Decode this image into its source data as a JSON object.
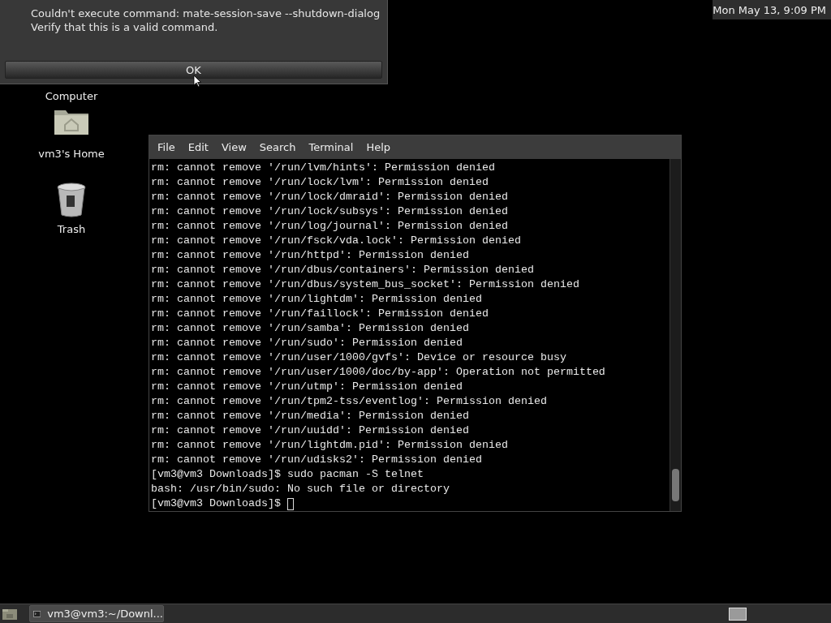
{
  "dialog": {
    "message": [
      "Couldn't execute command: mate-session-save --shutdown-dialog",
      "Verify that this is a valid command."
    ],
    "button": "OK"
  },
  "top_panel": {
    "clock": "Mon May 13,  9:09 PM"
  },
  "desktop_icons": [
    {
      "kind": "computer",
      "label": "Computer"
    },
    {
      "kind": "home",
      "label": "vm3's Home"
    },
    {
      "kind": "trash",
      "label": "Trash"
    }
  ],
  "terminal": {
    "menu": [
      "File",
      "Edit",
      "View",
      "Search",
      "Terminal",
      "Help"
    ],
    "lines": [
      "rm: cannot remove '/run/lvm/hints': Permission denied",
      "rm: cannot remove '/run/lock/lvm': Permission denied",
      "rm: cannot remove '/run/lock/dmraid': Permission denied",
      "rm: cannot remove '/run/lock/subsys': Permission denied",
      "rm: cannot remove '/run/log/journal': Permission denied",
      "rm: cannot remove '/run/fsck/vda.lock': Permission denied",
      "rm: cannot remove '/run/httpd': Permission denied",
      "rm: cannot remove '/run/dbus/containers': Permission denied",
      "rm: cannot remove '/run/dbus/system_bus_socket': Permission denied",
      "rm: cannot remove '/run/lightdm': Permission denied",
      "rm: cannot remove '/run/faillock': Permission denied",
      "rm: cannot remove '/run/samba': Permission denied",
      "rm: cannot remove '/run/sudo': Permission denied",
      "rm: cannot remove '/run/user/1000/gvfs': Device or resource busy",
      "rm: cannot remove '/run/user/1000/doc/by-app': Operation not permitted",
      "rm: cannot remove '/run/utmp': Permission denied",
      "rm: cannot remove '/run/tpm2-tss/eventlog': Permission denied",
      "rm: cannot remove '/run/media': Permission denied",
      "rm: cannot remove '/run/uuidd': Permission denied",
      "rm: cannot remove '/run/lightdm.pid': Permission denied",
      "rm: cannot remove '/run/udisks2': Permission denied",
      "[vm3@vm3 Downloads]$ sudo pacman -S telnet",
      "bash: /usr/bin/sudo: No such file or directory"
    ],
    "prompt": "[vm3@vm3 Downloads]$"
  },
  "taskbar": {
    "tasks": [
      "vm3@vm3:~/Downl..."
    ]
  }
}
